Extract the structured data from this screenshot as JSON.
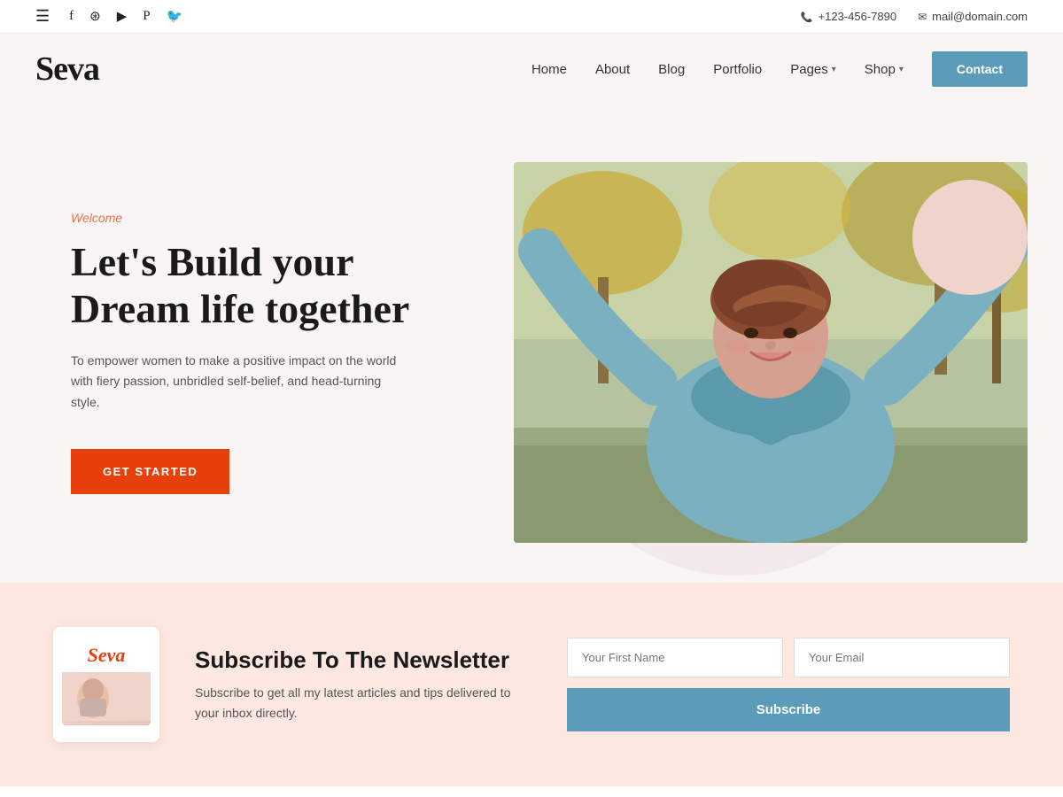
{
  "topbar": {
    "phone": "+123-456-7890",
    "email": "mail@domain.com",
    "social_icons": [
      "hamburger",
      "facebook",
      "instagram",
      "youtube",
      "pinterest",
      "twitter"
    ]
  },
  "nav": {
    "logo": "Seva",
    "links": [
      {
        "label": "Home",
        "has_dropdown": false
      },
      {
        "label": "About",
        "has_dropdown": false
      },
      {
        "label": "Blog",
        "has_dropdown": false
      },
      {
        "label": "Portfolio",
        "has_dropdown": false
      },
      {
        "label": "Pages",
        "has_dropdown": true
      },
      {
        "label": "Shop",
        "has_dropdown": true
      }
    ],
    "contact_btn": "Contact"
  },
  "hero": {
    "welcome_label": "Welcome",
    "title_line1": "Let's Build your",
    "title_line2": "Dream life together",
    "description": "To empower women to make a positive impact on the world with fiery passion, unbridled self-belief, and head-turning style.",
    "cta_btn": "GET STARTED"
  },
  "newsletter": {
    "card_logo": "Seva",
    "title": "Subscribe To The Newsletter",
    "description": "Subscribe to get all my latest articles and tips delivered to your inbox directly.",
    "first_name_placeholder": "Your First Name",
    "email_placeholder": "Your Email",
    "subscribe_btn": "Subscribe"
  }
}
